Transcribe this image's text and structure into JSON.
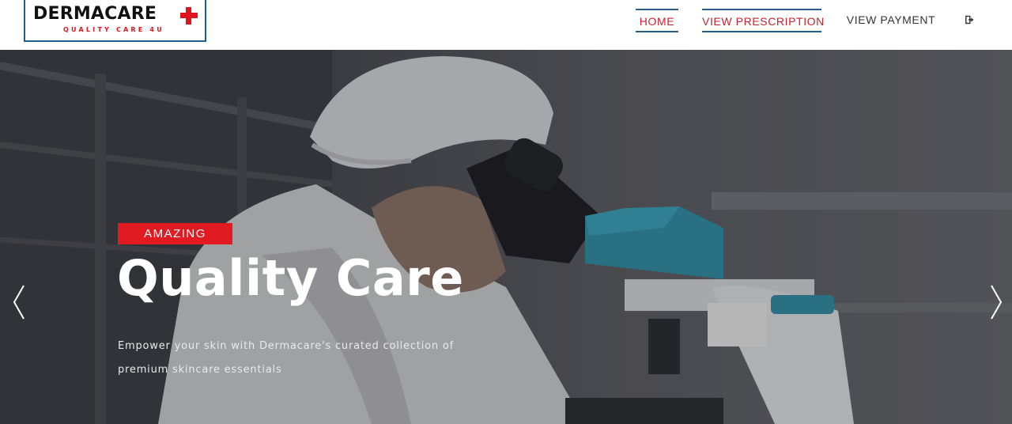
{
  "brand": {
    "name": "DERMACARE",
    "tagline": "QUALITY CARE 4U",
    "accent_color": "#e0141e",
    "border_color": "#1f5f8b"
  },
  "nav": {
    "items": [
      {
        "label": "HOME",
        "active": true
      },
      {
        "label": "VIEW PRESCRIPTION",
        "active": true
      },
      {
        "label": "VIEW PAYMENT",
        "active": false
      }
    ],
    "logout_icon": "sign-out-icon",
    "active_color": "#c8202f"
  },
  "hero": {
    "badge": "AMAZING",
    "title": "Quality Care",
    "description": "Empower your skin with Dermacare's curated collection of premium skincare essentials",
    "prev_icon": "chevron-left-icon",
    "next_icon": "chevron-right-icon",
    "image": "scientist-with-microscope-photo",
    "badge_color": "#e21b23"
  }
}
